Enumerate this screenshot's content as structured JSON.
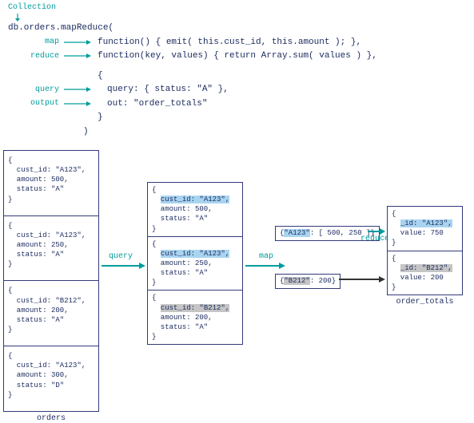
{
  "header": {
    "collection_label": "Collection",
    "main_call": "db.orders.mapReduce(",
    "args": {
      "map_label": "map",
      "map_code": "function() { emit( this.cust_id, this.amount ); },",
      "reduce_label": "reduce",
      "reduce_code": "function(key, values) { return Array.sum( values ) },",
      "opt_open": "{",
      "query_label": "query",
      "query_code": "query: { status: \"A\" },",
      "output_label": "output",
      "output_code": "out: \"order_totals\"",
      "opt_close": "}"
    },
    "close_paren": ")"
  },
  "flow": {
    "query_label": "query",
    "map_label": "map",
    "reduce_label": "reduce"
  },
  "orders": {
    "caption": "orders",
    "docs": [
      {
        "lines": [
          "{",
          "  cust_id: \"A123\",",
          "  amount: 500,",
          "  status: \"A\"",
          "}"
        ]
      },
      {
        "lines": [
          "{",
          "  cust_id: \"A123\",",
          "  amount: 250,",
          "  status: \"A\"",
          "}"
        ]
      },
      {
        "lines": [
          "{",
          "  cust_id: \"B212\",",
          "  amount: 200,",
          "  status: \"A\"",
          "}"
        ]
      },
      {
        "lines": [
          "{",
          "  cust_id: \"A123\",",
          "  amount: 300,",
          "  status: \"D\"",
          "}"
        ]
      }
    ]
  },
  "queried": {
    "docs": [
      {
        "hl": "blue",
        "line0": "{",
        "line1_hl": "cust_id: \"A123\",",
        "line2": "  amount: 500,",
        "line3": "  status: \"A\"",
        "line4": "}"
      },
      {
        "hl": "blue",
        "line0": "{",
        "line1_hl": "cust_id: \"A123\",",
        "line2": "  amount: 250,",
        "line3": "  status: \"A\"",
        "line4": "}"
      },
      {
        "hl": "gray",
        "line0": "{",
        "line1_hl": "cust_id: \"B212\",",
        "line2": "  amount: 200,",
        "line3": "  status: \"A\"",
        "line4": "}"
      }
    ]
  },
  "mapped": {
    "a": {
      "open": "{",
      "key": "\"A123\"",
      "rest": ": [ 500, 250 ]",
      "close": "}"
    },
    "b": {
      "open": "{",
      "key": "\"B212\"",
      "rest": ": 200",
      "close": "}"
    }
  },
  "output": {
    "caption": "order_totals",
    "docs": [
      {
        "hl": "blue",
        "open": "{",
        "id_hl": "_id: \"A123\",",
        "val": "  value: 750",
        "close": "}"
      },
      {
        "hl": "gray",
        "open": "{",
        "id_hl": "_id: \"B212\",",
        "val": "  value: 200",
        "close": "}"
      }
    ]
  }
}
